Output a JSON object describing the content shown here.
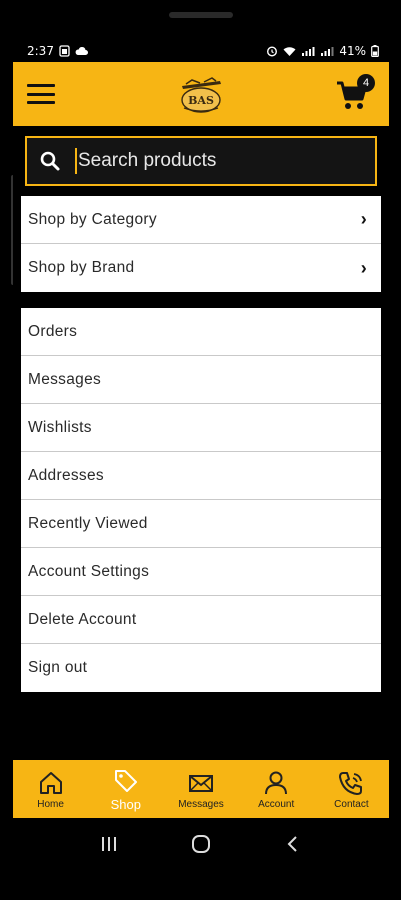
{
  "status": {
    "time": "2:37",
    "battery": "41%",
    "left_icons": [
      "sim-icon",
      "cloud-icon"
    ],
    "right_icons": [
      "alarm-icon",
      "wifi-icon",
      "signal-icon",
      "signal-icon",
      "battery-icon"
    ]
  },
  "header": {
    "logo_text": "BAS",
    "cart_count": "4"
  },
  "search": {
    "placeholder": "Search products",
    "value": ""
  },
  "shop_menu": [
    {
      "label": "Shop by Category",
      "icon": "chevron-right-icon"
    },
    {
      "label": "Shop by Brand",
      "icon": "chevron-right-icon"
    }
  ],
  "account_menu": [
    {
      "label": "Orders"
    },
    {
      "label": "Messages"
    },
    {
      "label": "Wishlists"
    },
    {
      "label": "Addresses"
    },
    {
      "label": "Recently Viewed"
    },
    {
      "label": "Account Settings"
    },
    {
      "label": "Delete Account"
    },
    {
      "label": "Sign out"
    }
  ],
  "bottom_nav": [
    {
      "label": "Home",
      "icon": "home-icon",
      "active": false
    },
    {
      "label": "Shop",
      "icon": "tag-icon",
      "active": true
    },
    {
      "label": "Messages",
      "icon": "envelope-icon",
      "active": false
    },
    {
      "label": "Account",
      "icon": "person-icon",
      "active": false
    },
    {
      "label": "Contact",
      "icon": "phone-icon",
      "active": false
    }
  ],
  "colors": {
    "accent": "#f7b514",
    "background": "#000000",
    "active_tab_label": "#ffffff"
  }
}
